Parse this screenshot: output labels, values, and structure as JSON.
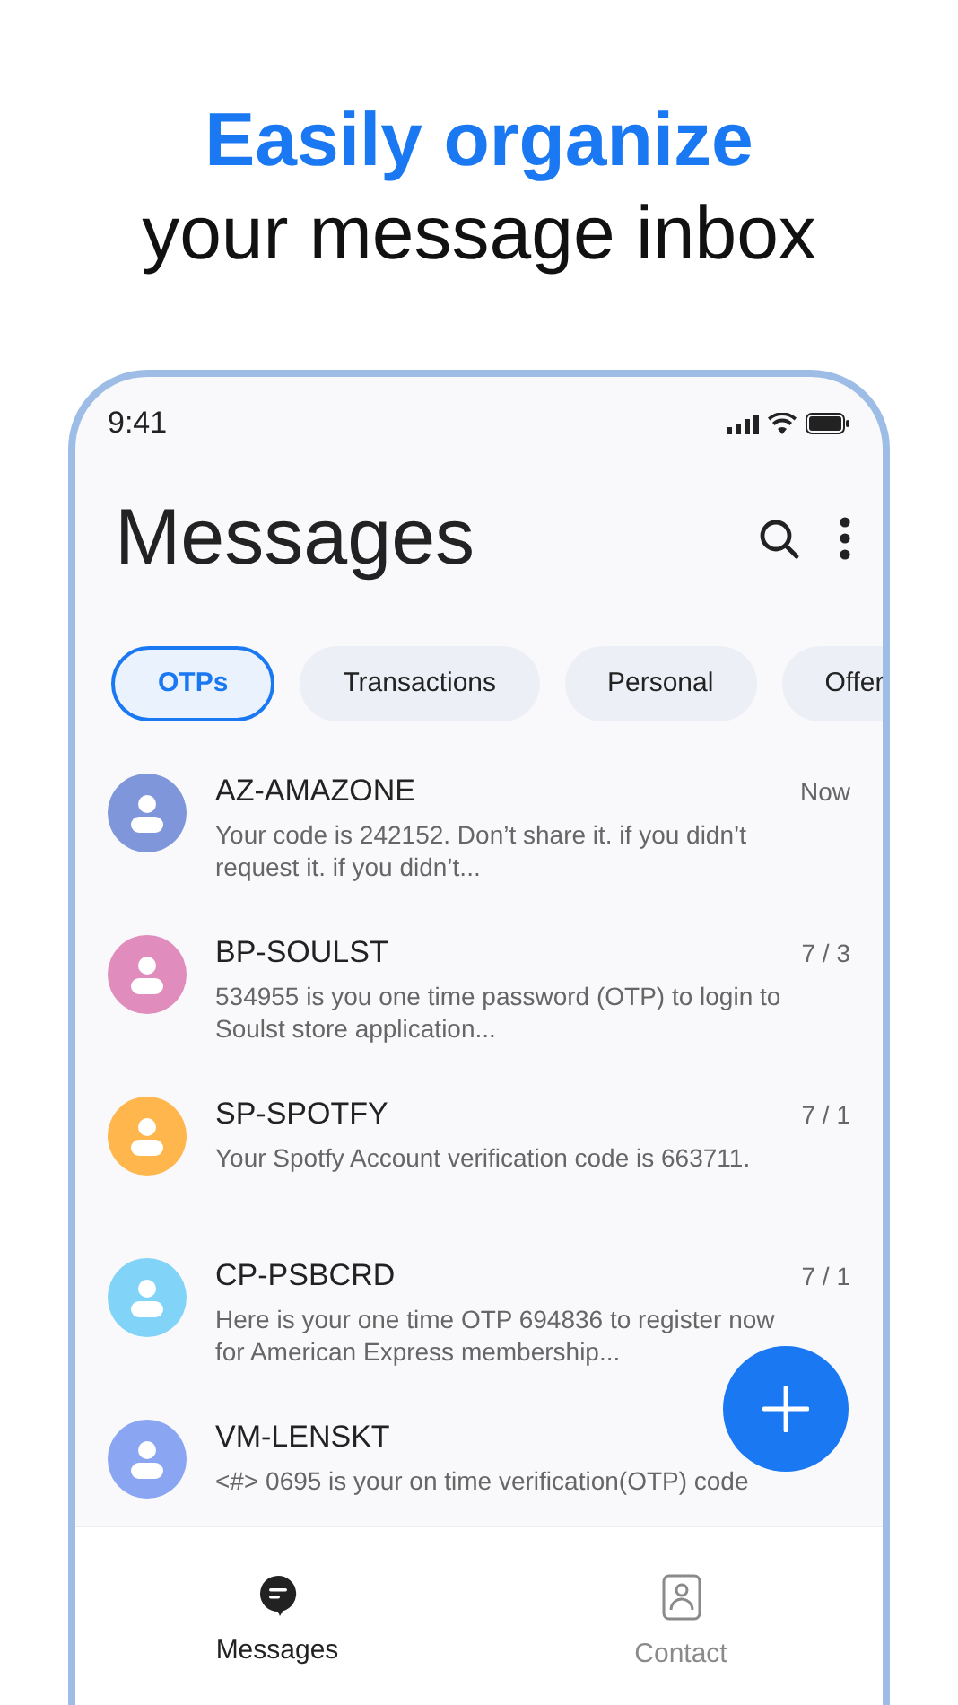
{
  "headline": {
    "accent": "Easily organize",
    "rest": "your message inbox"
  },
  "status_bar": {
    "time": "9:41"
  },
  "title": "Messages",
  "filters": [
    {
      "label": "OTPs",
      "selected": true
    },
    {
      "label": "Transactions",
      "selected": false
    },
    {
      "label": "Personal",
      "selected": false
    },
    {
      "label": "Offer",
      "selected": false
    }
  ],
  "messages": [
    {
      "sender": "AZ-AMAZONE",
      "time": "Now",
      "body": "Your code is 242152. Don’t share it. if you didn’t request it. if you didn’t...",
      "color": "#7f96db"
    },
    {
      "sender": "BP-SOULST",
      "time": "7 / 3",
      "body": "534955 is you one time password (OTP) to login to Soulst store application...",
      "color": "#e08cbd"
    },
    {
      "sender": "SP-SPOTFY",
      "time": "7 / 1",
      "body": "Your Spotfy Account verification code is 663711.",
      "color": "#ffb74d"
    },
    {
      "sender": "CP-PSBCRD",
      "time": "7 / 1",
      "body": "Here is your one time OTP 694836 to register now for American Express membership...",
      "color": "#81d4f7"
    },
    {
      "sender": "VM-LENSKT",
      "body": "<#> 0695 is your on time verification(OTP) code",
      "color": "#8aa6f2"
    }
  ],
  "nav": [
    {
      "label": "Messages",
      "kind": "messages",
      "selected": true
    },
    {
      "label": "Contact",
      "kind": "contact",
      "selected": false
    }
  ]
}
